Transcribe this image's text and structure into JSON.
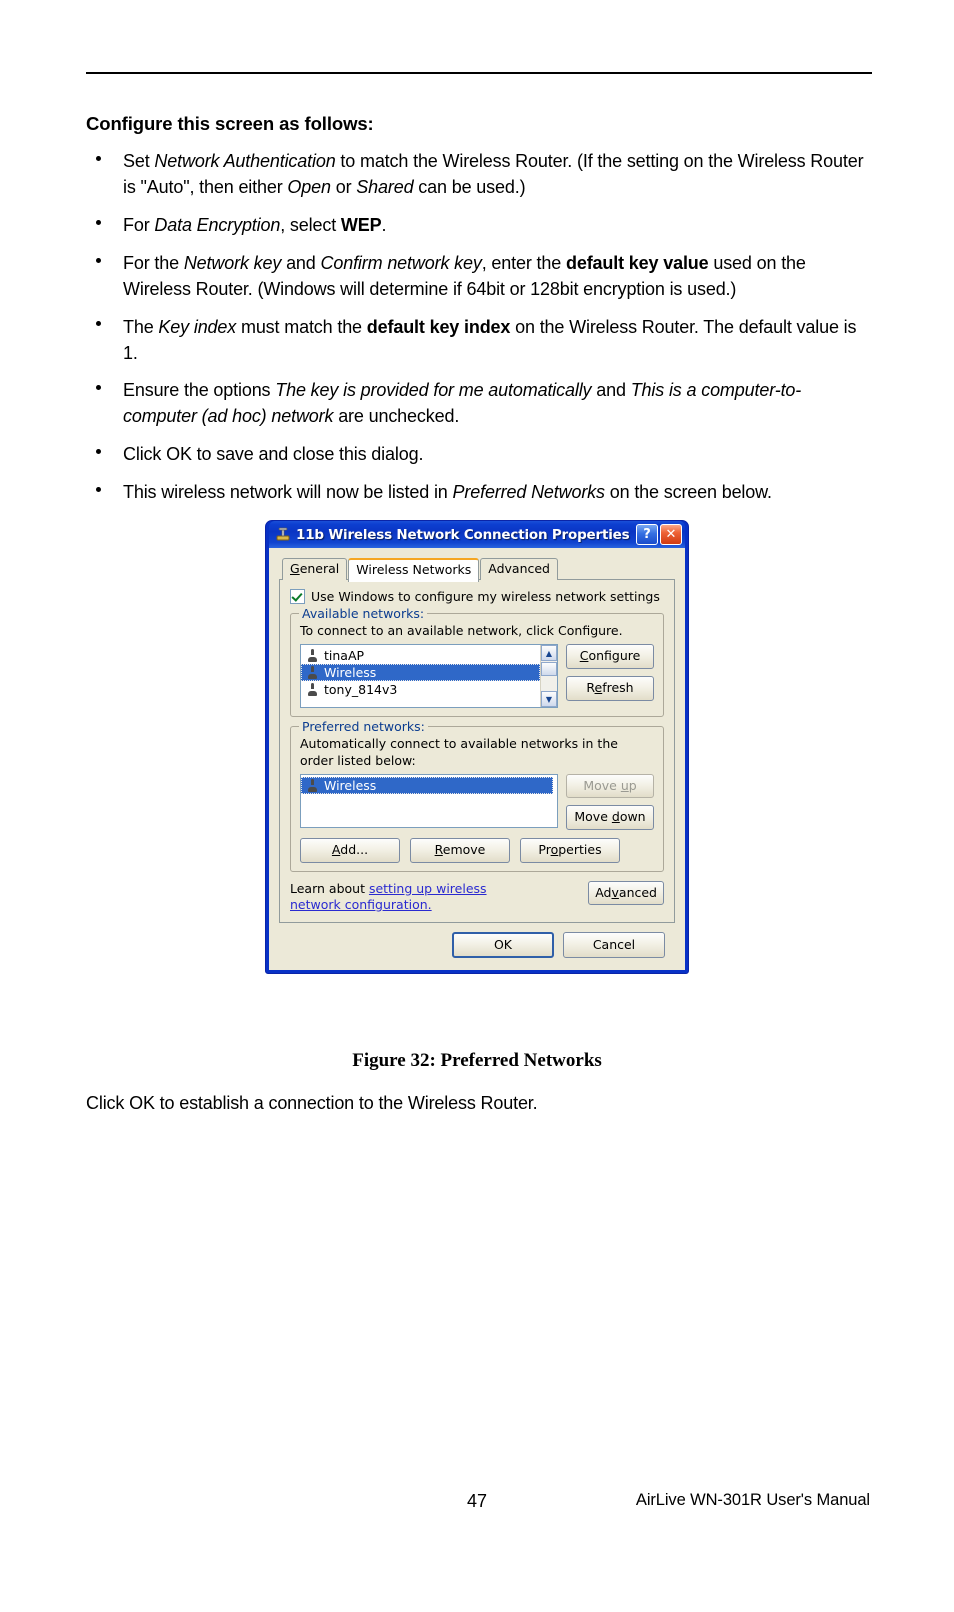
{
  "document": {
    "heading": "Configure this screen as follows:",
    "bullets": [
      [
        {
          "t": "Set ",
          "s": "n"
        },
        {
          "t": "Network Authentication",
          "s": "i"
        },
        {
          "t": " to match the Wireless Router. (If the setting on the Wireless Router is \"Auto\", then either ",
          "s": "n"
        },
        {
          "t": "Open",
          "s": "i"
        },
        {
          "t": " or ",
          "s": "n"
        },
        {
          "t": "Shared",
          "s": "i"
        },
        {
          "t": " can be used.)",
          "s": "n"
        }
      ],
      [
        {
          "t": "For ",
          "s": "n"
        },
        {
          "t": "Data Encryption",
          "s": "i"
        },
        {
          "t": ", select ",
          "s": "n"
        },
        {
          "t": "WEP",
          "s": "b"
        },
        {
          "t": ".",
          "s": "n"
        }
      ],
      [
        {
          "t": "For the ",
          "s": "n"
        },
        {
          "t": "Network key",
          "s": "i"
        },
        {
          "t": " and ",
          "s": "n"
        },
        {
          "t": "Confirm network key",
          "s": "i"
        },
        {
          "t": ", enter the ",
          "s": "n"
        },
        {
          "t": "default key value",
          "s": "b"
        },
        {
          "t": " used on the Wireless Router. (Windows will determine if 64bit or 128bit encryption is used.)",
          "s": "n"
        }
      ],
      [
        {
          "t": "The ",
          "s": "n"
        },
        {
          "t": "Key index",
          "s": "i"
        },
        {
          "t": " must match the ",
          "s": "n"
        },
        {
          "t": "default key index",
          "s": "b"
        },
        {
          "t": " on the Wireless Router. The default value is 1.",
          "s": "n"
        }
      ],
      [
        {
          "t": "Ensure the options ",
          "s": "n"
        },
        {
          "t": "The key is provided for me automatically",
          "s": "i"
        },
        {
          "t": " and ",
          "s": "n"
        },
        {
          "t": "This is a computer-to-computer (ad hoc) network",
          "s": "i"
        },
        {
          "t": " are unchecked.",
          "s": "n"
        }
      ],
      [
        {
          "t": "Click OK to save and close this dialog.",
          "s": "n"
        }
      ],
      [
        {
          "t": "This wireless network will now be listed in ",
          "s": "n"
        },
        {
          "t": "Preferred Networks",
          "s": "i"
        },
        {
          "t": " on the screen below.",
          "s": "n"
        }
      ]
    ],
    "figure_caption": "Figure 32: Preferred Networks",
    "closing_text": "Click OK to establish a connection to the Wireless Router.",
    "page_number": "47",
    "footer_note": "AirLive WN-301R User's Manual"
  },
  "dialog": {
    "title": "11b Wireless Network Connection Properties",
    "title_icon": "network-adapter-icon",
    "help_button": "?",
    "close_button": "✕",
    "tabs": [
      {
        "label": "General",
        "active": false
      },
      {
        "label": "Wireless Networks",
        "active": true
      },
      {
        "label": "Advanced",
        "active": false
      }
    ],
    "use_windows_checkbox": {
      "label": "Use Windows to configure my wireless network settings",
      "checked": true
    },
    "available_networks": {
      "legend": "Available networks:",
      "hint": "To connect to an available network, click Configure.",
      "items": [
        {
          "name": "tinaAP",
          "selected": false
        },
        {
          "name": "Wireless",
          "selected": true
        },
        {
          "name": "tony_814v3",
          "selected": false
        }
      ],
      "buttons": [
        {
          "label": "Configure",
          "disabled": false
        },
        {
          "label": "Refresh",
          "disabled": false
        }
      ]
    },
    "preferred_networks": {
      "legend": "Preferred networks:",
      "hint": "Automatically connect to available networks in the order listed below:",
      "items": [
        {
          "name": "Wireless",
          "selected": true
        }
      ],
      "side_buttons": [
        {
          "label": "Move up",
          "disabled": true
        },
        {
          "label": "Move down",
          "disabled": false
        }
      ],
      "row_buttons": [
        {
          "label": "Add...",
          "disabled": false
        },
        {
          "label": "Remove",
          "disabled": false
        },
        {
          "label": "Properties",
          "disabled": false
        }
      ]
    },
    "learn": {
      "prefix": "Learn about ",
      "link": "setting up wireless network configuration.",
      "advanced_button": "Advanced"
    },
    "footer_buttons": [
      {
        "label": "OK",
        "default": true
      },
      {
        "label": "Cancel",
        "default": false
      }
    ]
  },
  "colors": {
    "titlebar_blue": "#0a35c4",
    "selection_blue": "#2f68c8",
    "dialog_face": "#ece9d8",
    "legend_text": "#0b3c8f",
    "link_blue": "#2a2ad0",
    "tab_accent": "#f5a623"
  }
}
